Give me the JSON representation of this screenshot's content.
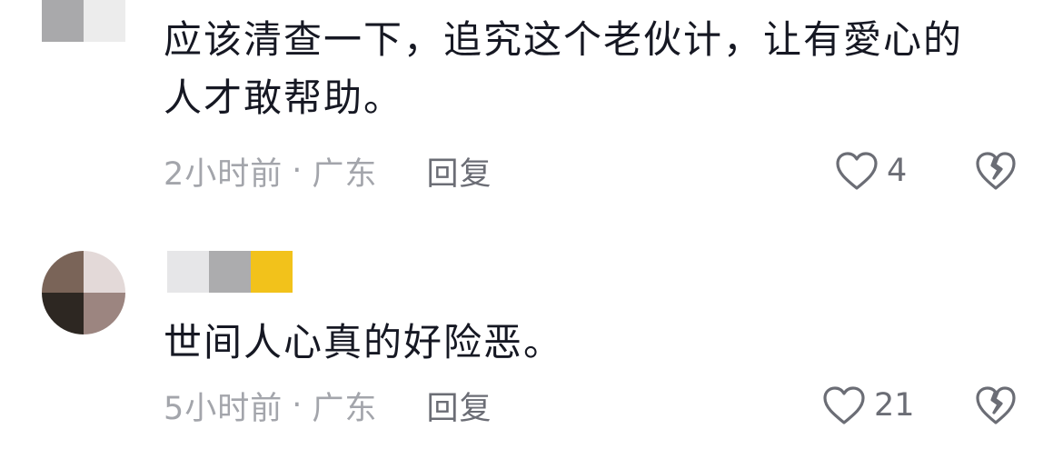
{
  "comments": [
    {
      "text": "应该清查一下，追究这个老伙计，让有愛心的人才敢帮助。",
      "time": "2小时前",
      "location": "广东",
      "separator": "·",
      "reply_label": "回复",
      "like_count": "4"
    },
    {
      "text": "世间人心真的好险恶。",
      "time": "5小时前",
      "location": "广东",
      "separator": "·",
      "reply_label": "回复",
      "like_count": "21"
    }
  ],
  "icons": {
    "like": "heart-outline-icon",
    "dislike": "broken-heart-icon"
  },
  "colors": {
    "text_primary": "#161823",
    "text_meta": "#a3a5ab",
    "text_action": "#6b6d75",
    "mosaic_yellow": "#f2c21b"
  }
}
